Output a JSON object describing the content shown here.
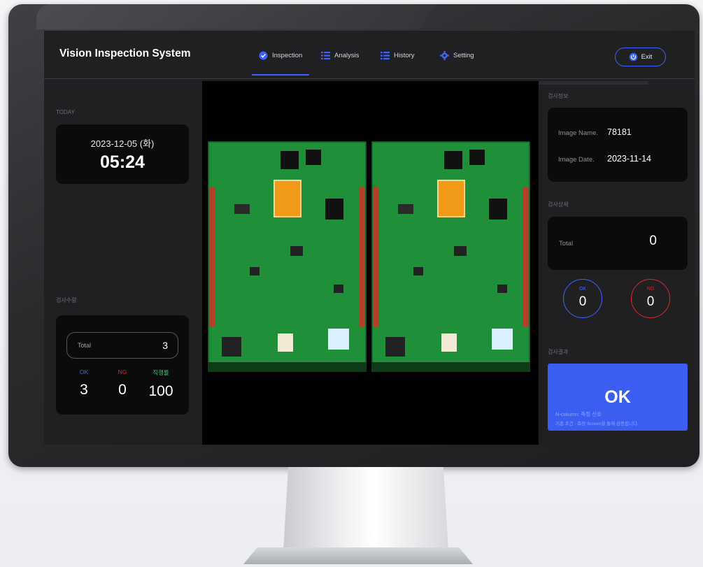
{
  "app": {
    "title": "Vision Inspection System"
  },
  "tabs": [
    {
      "label": "Inspection",
      "icon": "check-circle-icon",
      "active": true
    },
    {
      "label": "Analysis",
      "icon": "list-icon",
      "active": false
    },
    {
      "label": "History",
      "icon": "list-icon",
      "active": false
    },
    {
      "label": "Setting",
      "icon": "gear-icon",
      "active": false
    }
  ],
  "header": {
    "exit_label": "Exit"
  },
  "left": {
    "today_label": "TODAY",
    "date": "2023-12-05 (화)",
    "time": "05:24",
    "count_section_label": "검사수량",
    "total_label": "Total",
    "total_value": "3",
    "stats": [
      {
        "label": "OK",
        "value": "3",
        "color": "#3d63ff"
      },
      {
        "label": "NG",
        "value": "0",
        "color": "#e0262b"
      },
      {
        "label": "직행률",
        "value": "100",
        "color": "#3fbf74"
      }
    ]
  },
  "right": {
    "info_section_label": "검사정보",
    "image_name_label": "Image Name.",
    "image_name_value": "78181",
    "image_date_label": "Image Date.",
    "image_date_value": "2023-11-14",
    "detail_section_label": "검사상세",
    "detail_total_label": "Total",
    "detail_total_value": "0",
    "ok_label": "OK",
    "ok_value": "0",
    "ng_label": "NG",
    "ng_value": "0",
    "result_section_label": "검사결과",
    "result_value": "OK",
    "result_note_1": "N-column: 측정 신호",
    "result_note_2": "기준 조건 : 측정 Screen을 통해 검증됩니다."
  },
  "colors": {
    "accent": "#3d63ff",
    "ok": "#3d63ff",
    "ng": "#e0262b",
    "rate": "#3fbf74",
    "result_bg": "#3b5ef0"
  }
}
